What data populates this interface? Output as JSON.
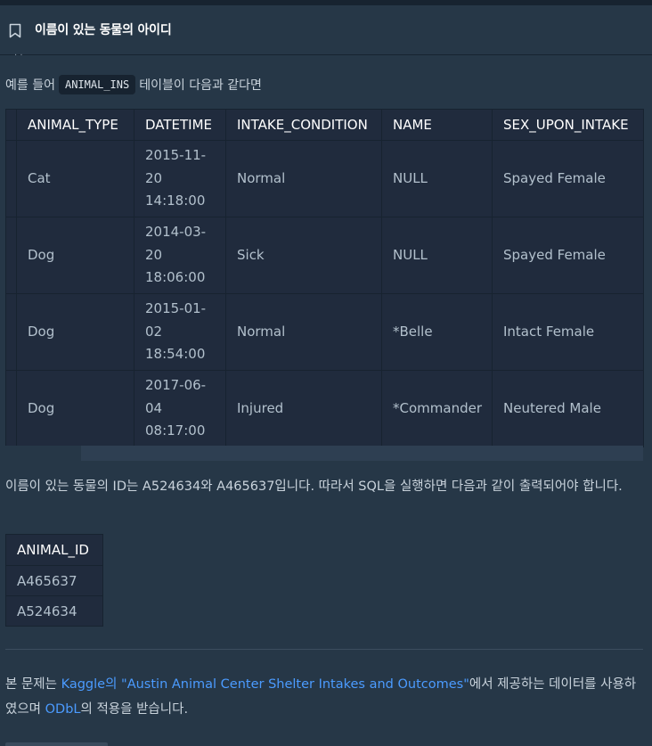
{
  "header": {
    "title": "이름이 있는 동물의 아이디",
    "icon": "bookmark-icon"
  },
  "intro": {
    "before": "예를 들어",
    "table_name": "ANIMAL_INS",
    "after": "테이블이 다음과 같다면"
  },
  "table1": {
    "columns": [
      "ANIMAL_TYPE",
      "DATETIME",
      "INTAKE_CONDITION",
      "NAME",
      "SEX_UPON_INTAKE"
    ],
    "rows": [
      {
        "type": "Cat",
        "datetime": [
          "2015-11-",
          "20",
          "14:18:00"
        ],
        "condition": "Normal",
        "name": "NULL",
        "sex": "Spayed Female"
      },
      {
        "type": "Dog",
        "datetime": [
          "2014-03-",
          "20",
          "18:06:00"
        ],
        "condition": "Sick",
        "name": "NULL",
        "sex": "Spayed Female"
      },
      {
        "type": "Dog",
        "datetime": [
          "2015-01-",
          "02",
          "18:54:00"
        ],
        "condition": "Normal",
        "name": "*Belle",
        "sex": "Intact Female"
      },
      {
        "type": "Dog",
        "datetime": [
          "2017-06-",
          "04",
          "08:17:00"
        ],
        "condition": "Injured",
        "name": "*Commander",
        "sex": "Neutered Male"
      }
    ]
  },
  "result_text": "이름이 있는 동물의 ID는 A524634와 A465637입니다. 따라서 SQL을 실행하면 다음과 같이 출력되어야 합니다.",
  "table2": {
    "column": "ANIMAL_ID",
    "rows": [
      "A465637",
      "A524634"
    ]
  },
  "footer": {
    "before": "본 문제는 ",
    "link1": "Kaggle의 \"Austin Animal Center Shelter Intakes and Outcomes\"",
    "middle": "에서 제공하는 데이터를 사용하였으며 ",
    "link2": "ODbL",
    "after": "의 적용을 받습니다."
  },
  "colors": {
    "background": "#263747",
    "table_bg": "#202b3d",
    "link": "#4b9bff"
  }
}
